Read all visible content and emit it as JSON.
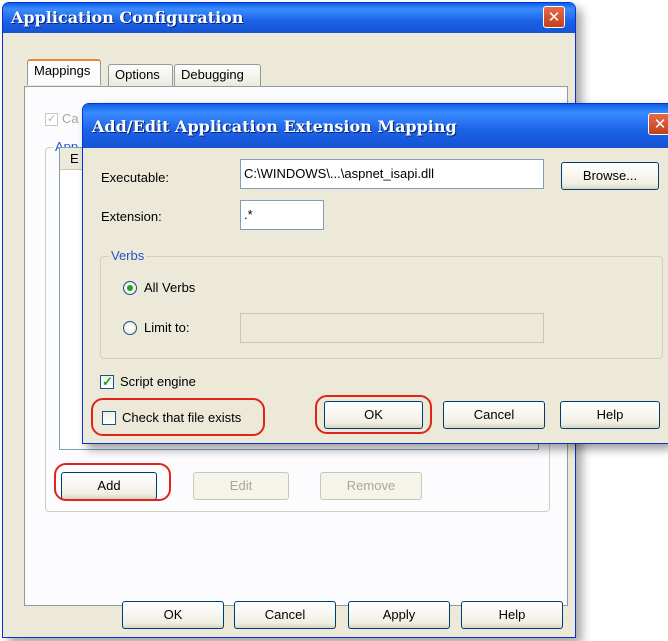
{
  "main_window": {
    "title": "Application Configuration",
    "close_glyph": "✕",
    "tabs": [
      {
        "label": "Mappings",
        "active": true
      },
      {
        "label": "Options",
        "active": false
      },
      {
        "label": "Debugging",
        "active": false
      }
    ],
    "cache_checkbox_partial": "Ca",
    "group_partial": "App",
    "column_partial": "E",
    "buttons": {
      "add": "Add",
      "edit": "Edit",
      "remove": "Remove"
    },
    "footer": {
      "ok": "OK",
      "cancel": "Cancel",
      "apply": "Apply",
      "help": "Help"
    }
  },
  "dialog": {
    "title": "Add/Edit Application Extension Mapping",
    "close_glyph": "✕",
    "executable_label": "Executable:",
    "executable_value": "C:\\WINDOWS\\...\\aspnet_isapi.dll",
    "browse_label": "Browse...",
    "extension_label": "Extension:",
    "extension_value": ".*",
    "verbs_legend": "Verbs",
    "all_verbs_label": "All Verbs",
    "limit_to_label": "Limit to:",
    "limit_to_value": "",
    "script_engine_label": "Script engine",
    "script_engine_checked": true,
    "check_file_label": "Check that file exists",
    "check_file_checked": false,
    "ok_label": "OK",
    "cancel_label": "Cancel",
    "help_label": "Help",
    "check_glyph": "✓"
  },
  "colors": {
    "titlebar": "#1b62e6",
    "highlight": "#e0241b",
    "window_bg": "#ece9d8"
  }
}
